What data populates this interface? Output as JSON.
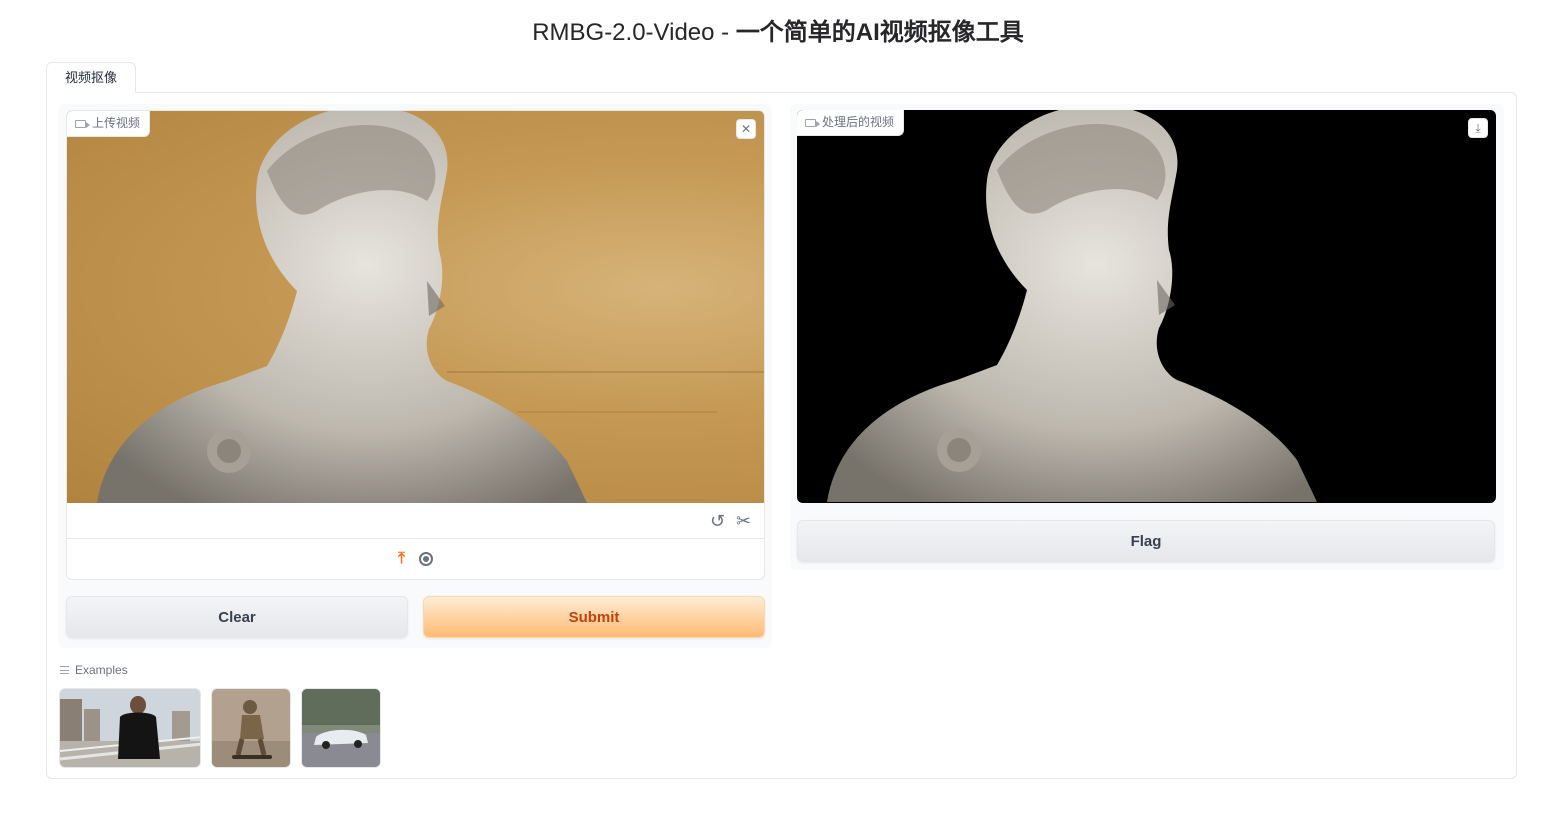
{
  "header": {
    "title_prefix": "RMBG-2.0-Video - ",
    "title_main": "一个简单的AI视频抠像工具"
  },
  "tabs": [
    {
      "label": "视频抠像",
      "active": true
    }
  ],
  "input_video": {
    "label": "上传视频",
    "icon": "video-camera-icon",
    "close_icon": "close-icon",
    "trim_icons": [
      "undo-icon",
      "scissors-icon"
    ],
    "source_icons": [
      "upload-icon",
      "webcam-icon"
    ]
  },
  "output_video": {
    "label": "处理后的视频",
    "icon": "video-camera-icon",
    "download_icon": "download-icon"
  },
  "buttons": {
    "clear": "Clear",
    "submit": "Submit",
    "flag": "Flag"
  },
  "examples": {
    "label": "Examples",
    "items": [
      "man-on-bridge",
      "figure-on-skateboard",
      "white-sports-car"
    ]
  },
  "colors": {
    "accent": "#f97316",
    "primary_button_text": "#c2410c",
    "output_background": "#000000"
  }
}
